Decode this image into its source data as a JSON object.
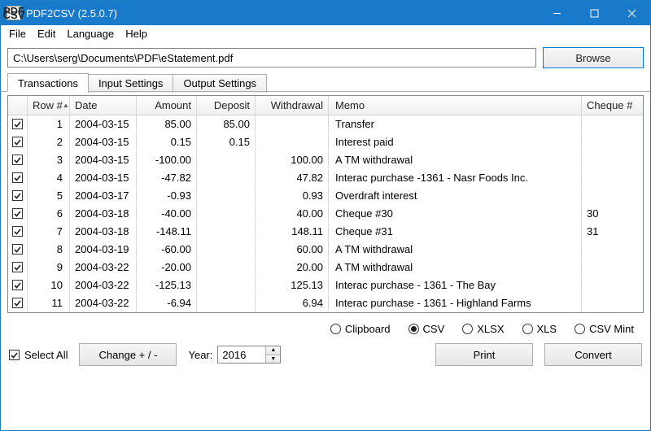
{
  "window": {
    "title": "PDF2CSV (2.5.0.7)"
  },
  "menu": {
    "file": "File",
    "edit": "Edit",
    "language": "Language",
    "help": "Help"
  },
  "toolbar": {
    "path": "C:\\Users\\serg\\Documents\\PDF\\eStatement.pdf",
    "browse": "Browse"
  },
  "tabs": {
    "t1": "Transactions",
    "t2": "Input Settings",
    "t3": "Output Settings"
  },
  "grid": {
    "headers": {
      "rownum": "Row #",
      "date": "Date",
      "amount": "Amount",
      "deposit": "Deposit",
      "withdrawal": "Withdrawal",
      "memo": "Memo",
      "cheque": "Cheque #"
    },
    "rows": [
      {
        "n": "1",
        "date": "2004-03-15",
        "amt": "85.00",
        "dep": "85.00",
        "wd": "",
        "memo": "Transfer",
        "chq": ""
      },
      {
        "n": "2",
        "date": "2004-03-15",
        "amt": "0.15",
        "dep": "0.15",
        "wd": "",
        "memo": "Interest paid",
        "chq": ""
      },
      {
        "n": "3",
        "date": "2004-03-15",
        "amt": "-100.00",
        "dep": "",
        "wd": "100.00",
        "memo": "A TM withdrawal",
        "chq": ""
      },
      {
        "n": "4",
        "date": "2004-03-15",
        "amt": "-47.82",
        "dep": "",
        "wd": "47.82",
        "memo": "Interac purchase -1361 - Nasr Foods Inc.",
        "chq": ""
      },
      {
        "n": "5",
        "date": "2004-03-17",
        "amt": "-0.93",
        "dep": "",
        "wd": "0.93",
        "memo": "Overdraft interest",
        "chq": ""
      },
      {
        "n": "6",
        "date": "2004-03-18",
        "amt": "-40.00",
        "dep": "",
        "wd": "40.00",
        "memo": "Cheque #30",
        "chq": "30"
      },
      {
        "n": "7",
        "date": "2004-03-18",
        "amt": "-148.11",
        "dep": "",
        "wd": "148.11",
        "memo": "Cheque #31",
        "chq": "31"
      },
      {
        "n": "8",
        "date": "2004-03-19",
        "amt": "-60.00",
        "dep": "",
        "wd": "60.00",
        "memo": "A TM withdrawal",
        "chq": ""
      },
      {
        "n": "9",
        "date": "2004-03-22",
        "amt": "-20.00",
        "dep": "",
        "wd": "20.00",
        "memo": "A TM withdrawal",
        "chq": ""
      },
      {
        "n": "10",
        "date": "2004-03-22",
        "amt": "-125.13",
        "dep": "",
        "wd": "125.13",
        "memo": "Interac purchase - 1361 - The Bay",
        "chq": ""
      },
      {
        "n": "11",
        "date": "2004-03-22",
        "amt": "-6.94",
        "dep": "",
        "wd": "6.94",
        "memo": "Interac purchase - 1361 - Highland Farms",
        "chq": ""
      }
    ]
  },
  "format": {
    "clipboard": "Clipboard",
    "csv": "CSV",
    "xlsx": "XLSX",
    "xls": "XLS",
    "csvmint": "CSV Mint",
    "selected": "csv"
  },
  "bottom": {
    "selectall": "Select All",
    "change": "Change + / -",
    "year_label": "Year:",
    "year": "2016",
    "print": "Print",
    "convert": "Convert"
  }
}
